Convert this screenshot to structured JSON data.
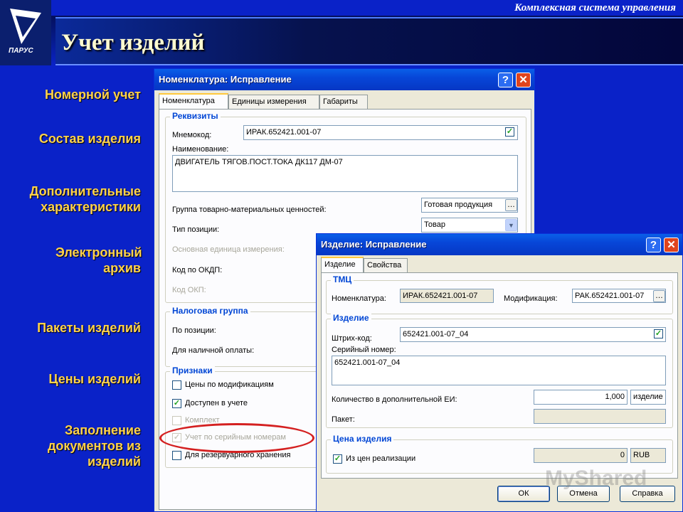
{
  "header": {
    "subtitle": "Комплексная система управления",
    "title": "Учет изделий",
    "logo_text": "ПАРУС"
  },
  "nav": {
    "items": [
      {
        "label": "Номерной учет"
      },
      {
        "label": "Состав изделия"
      },
      {
        "label": "Дополнительные характеристики"
      },
      {
        "label": "Электронный архив"
      },
      {
        "label": "Пакеты изделий"
      },
      {
        "label": "Цены изделий"
      },
      {
        "label": "Заполнение документов из изделий"
      }
    ]
  },
  "dialog1": {
    "title": "Номенклатура: Исправление",
    "help_btn": "?",
    "close_btn": "✕",
    "tabs": [
      "Номенклатура",
      "Единицы измерения",
      "Габариты"
    ],
    "groups": {
      "requisites": "Реквизиты",
      "tax": "Налоговая группа",
      "signs": "Признаки"
    },
    "labels": {
      "mnemocode": "Мнемокод:",
      "name": "Наименование:",
      "goods_group": "Группа товарно-материальных ценностей:",
      "position_type": "Тип позиции:",
      "base_unit": "Основная единица измерения:",
      "okdp": "Код по ОКДП:",
      "okp": "Код ОКП:",
      "by_position": "По позиции:",
      "cash_payment": "Для наличной оплаты:"
    },
    "values": {
      "mnemocode": "ИРАК.652421.001-07",
      "name": "ДВИГАТЕЛЬ ТЯГОВ.ПОСТ.ТОКА ДК117 ДМ-07",
      "goods_group": "Готовая продукция",
      "position_type": "Товар"
    },
    "checkboxes": [
      {
        "label": "Цены по модификациям",
        "checked": false,
        "enabled": true
      },
      {
        "label": "Доступен в учете",
        "checked": true,
        "enabled": true
      },
      {
        "label": "Комплект",
        "checked": false,
        "enabled": false
      },
      {
        "label": "Учет по серийным номерам",
        "checked": true,
        "enabled": false
      },
      {
        "label": "Для резервуарного хранения",
        "checked": false,
        "enabled": true
      }
    ]
  },
  "dialog2": {
    "title": "Изделие: Исправление",
    "help_btn": "?",
    "close_btn": "✕",
    "tabs": [
      "Изделие",
      "Свойства"
    ],
    "groups": {
      "tmc": "ТМЦ",
      "item": "Изделие",
      "price": "Цена изделия"
    },
    "labels": {
      "nomenclature": "Номенклатура:",
      "modification": "Модификация:",
      "barcode": "Штрих-код:",
      "serial": "Серийный номер:",
      "qty_add_unit": "Количество в дополнительной ЕИ:",
      "package": "Пакет:",
      "from_sale_prices": "Из цен реализации"
    },
    "values": {
      "nomenclature": "ИРАК.652421.001-07",
      "modification": "РАК.652421.001-07",
      "barcode": "652421.001-07_04",
      "serial": "652421.001-07_04",
      "qty": "1,000",
      "qty_unit": "изделие",
      "package": "",
      "price": "0",
      "currency": "RUB"
    },
    "buttons": {
      "ok": "ОК",
      "cancel": "Отмена",
      "help": "Справка"
    }
  },
  "watermark": "MyShared"
}
